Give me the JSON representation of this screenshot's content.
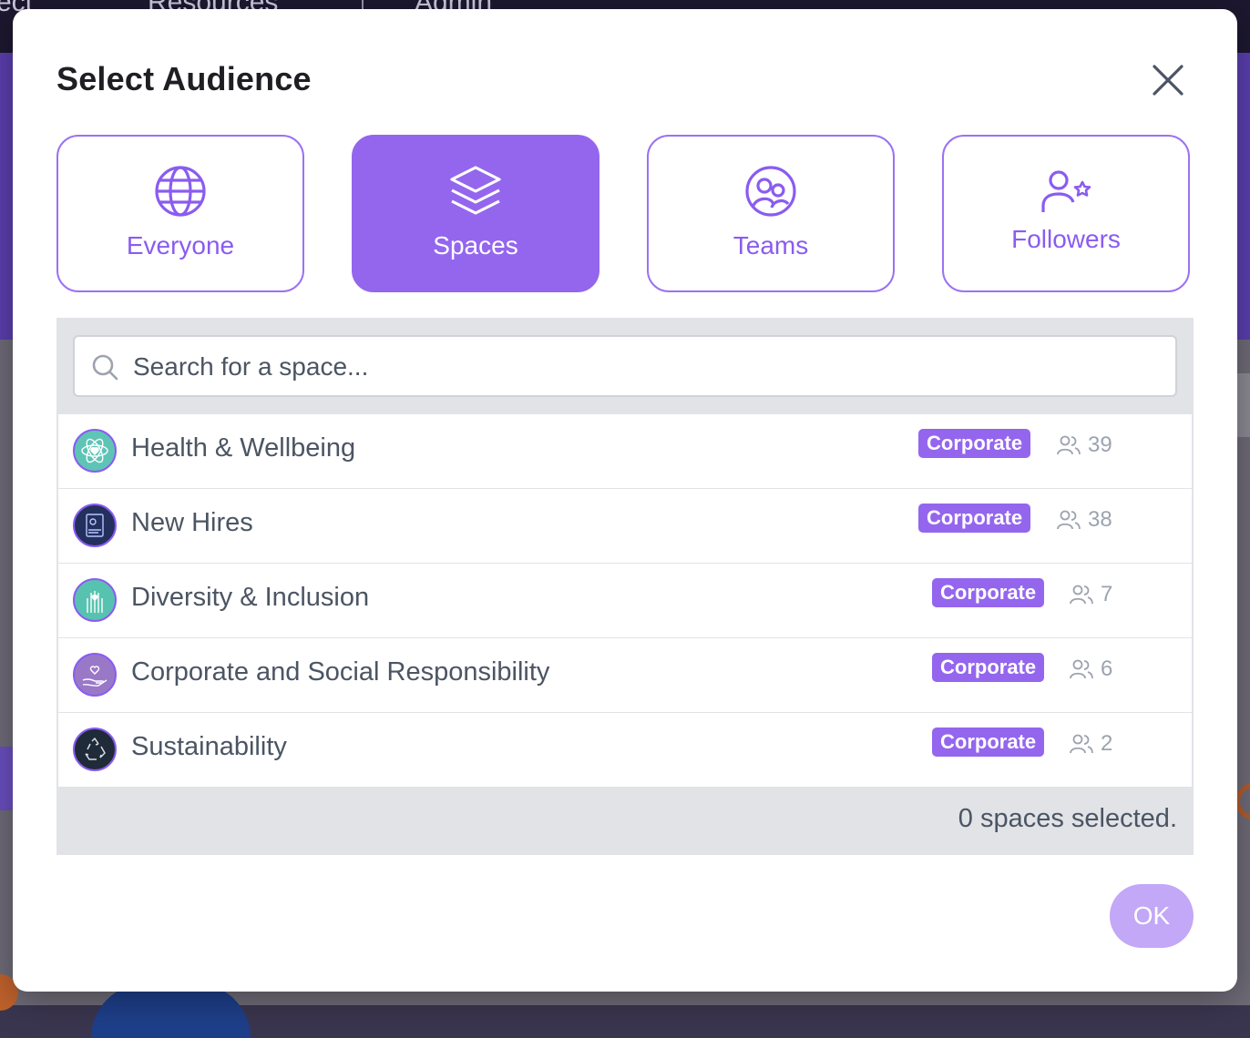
{
  "background": {
    "nav_items": [
      "ect",
      "Resources",
      "Admin"
    ]
  },
  "modal": {
    "title": "Select Audience",
    "tabs": [
      {
        "label": "Everyone",
        "icon": "globe-icon",
        "active": false
      },
      {
        "label": "Spaces",
        "icon": "layers-icon",
        "active": true
      },
      {
        "label": "Teams",
        "icon": "team-icon",
        "active": false
      },
      {
        "label": "Followers",
        "icon": "follower-star-icon",
        "active": false
      }
    ],
    "search": {
      "placeholder": "Search for a space..."
    },
    "spaces": [
      {
        "name": "Health & Wellbeing",
        "badge": "Corporate",
        "members": "39",
        "avatar_color": "#5ec4b6"
      },
      {
        "name": "New Hires",
        "badge": "Corporate",
        "members": "38",
        "avatar_color": "#23305e"
      },
      {
        "name": "Diversity & Inclusion",
        "badge": "Corporate",
        "members": "7",
        "avatar_color": "#58c2b0"
      },
      {
        "name": "Corporate and Social Responsibility",
        "badge": "Corporate",
        "members": "6",
        "avatar_color": "#9a78c8"
      },
      {
        "name": "Sustainability",
        "badge": "Corporate",
        "members": "2",
        "avatar_color": "#1f2b38"
      }
    ],
    "selection_status": "0 spaces selected.",
    "ok_label": "OK"
  },
  "colors": {
    "accent": "#9466ee",
    "accent_light": "#c2a8f6",
    "panel": "#e1e3e7"
  }
}
